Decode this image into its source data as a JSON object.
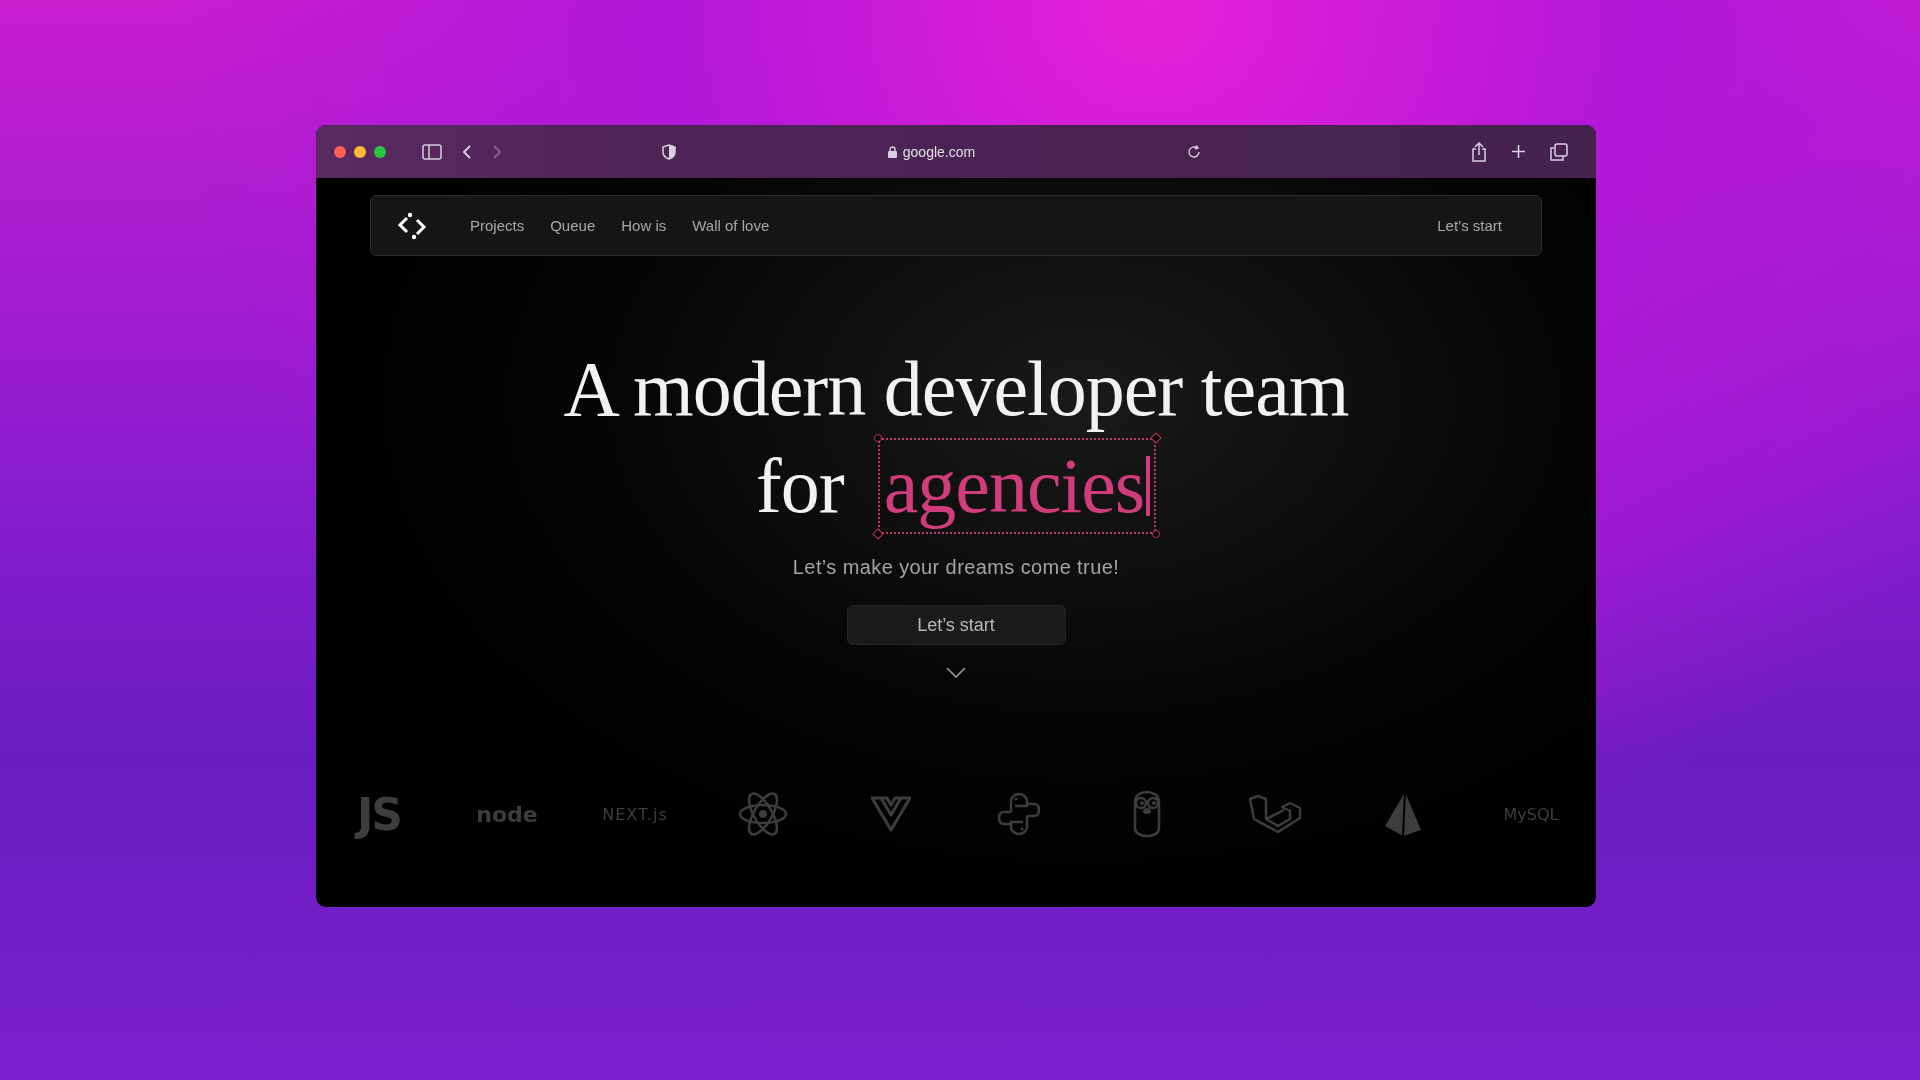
{
  "browser": {
    "url": "google.com"
  },
  "nav": {
    "links": [
      {
        "label": "Projects"
      },
      {
        "label": "Queue"
      },
      {
        "label": "How is"
      },
      {
        "label": "Wall of love"
      }
    ],
    "cta": "Let’s start"
  },
  "hero": {
    "title_line_1": "A modern developer team",
    "title_prefix": "for",
    "highlight": "agencies",
    "subtitle": "Let’s make your dreams come true!",
    "button": "Let’s start"
  },
  "tech_logos": [
    {
      "kind": "js",
      "text": "JS"
    },
    {
      "kind": "node",
      "text": "node"
    },
    {
      "kind": "next",
      "text": "NEXT.js"
    },
    {
      "kind": "react"
    },
    {
      "kind": "vue"
    },
    {
      "kind": "python"
    },
    {
      "kind": "gopher"
    },
    {
      "kind": "laravel"
    },
    {
      "kind": "prisma"
    },
    {
      "kind": "mysql",
      "text": "MySQL"
    }
  ]
}
